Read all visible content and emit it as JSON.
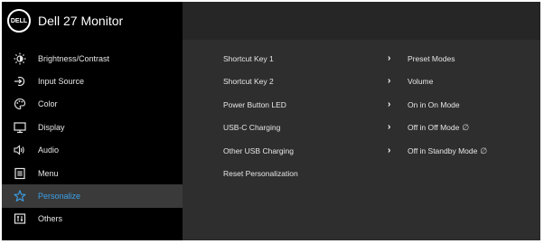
{
  "header": {
    "logo_text": "DELL",
    "title": "Dell 27 Monitor"
  },
  "sidebar": {
    "items": [
      {
        "label": "Brightness/Contrast",
        "icon": "brightness-icon"
      },
      {
        "label": "Input Source",
        "icon": "input-source-icon"
      },
      {
        "label": "Color",
        "icon": "color-icon"
      },
      {
        "label": "Display",
        "icon": "display-icon"
      },
      {
        "label": "Audio",
        "icon": "audio-icon"
      },
      {
        "label": "Menu",
        "icon": "menu-icon"
      },
      {
        "label": "Personalize",
        "icon": "star-icon",
        "active": true
      },
      {
        "label": "Others",
        "icon": "others-icon"
      }
    ]
  },
  "options": [
    {
      "label": "Shortcut Key 1",
      "value": "Preset Modes"
    },
    {
      "label": "Shortcut Key 2",
      "value": "Volume"
    },
    {
      "label": "Power Button LED",
      "value": "On in On Mode"
    },
    {
      "label": "USB-C Charging",
      "value": "Off in Off Mode"
    },
    {
      "label": "Other USB Charging",
      "value": "Off in Standby Mode"
    },
    {
      "label": "Reset Personalization",
      "value": ""
    }
  ],
  "colors": {
    "accent": "#3aa0e8",
    "sidebar_bg": "#000000",
    "panel_bg": "#2e2e2e"
  }
}
